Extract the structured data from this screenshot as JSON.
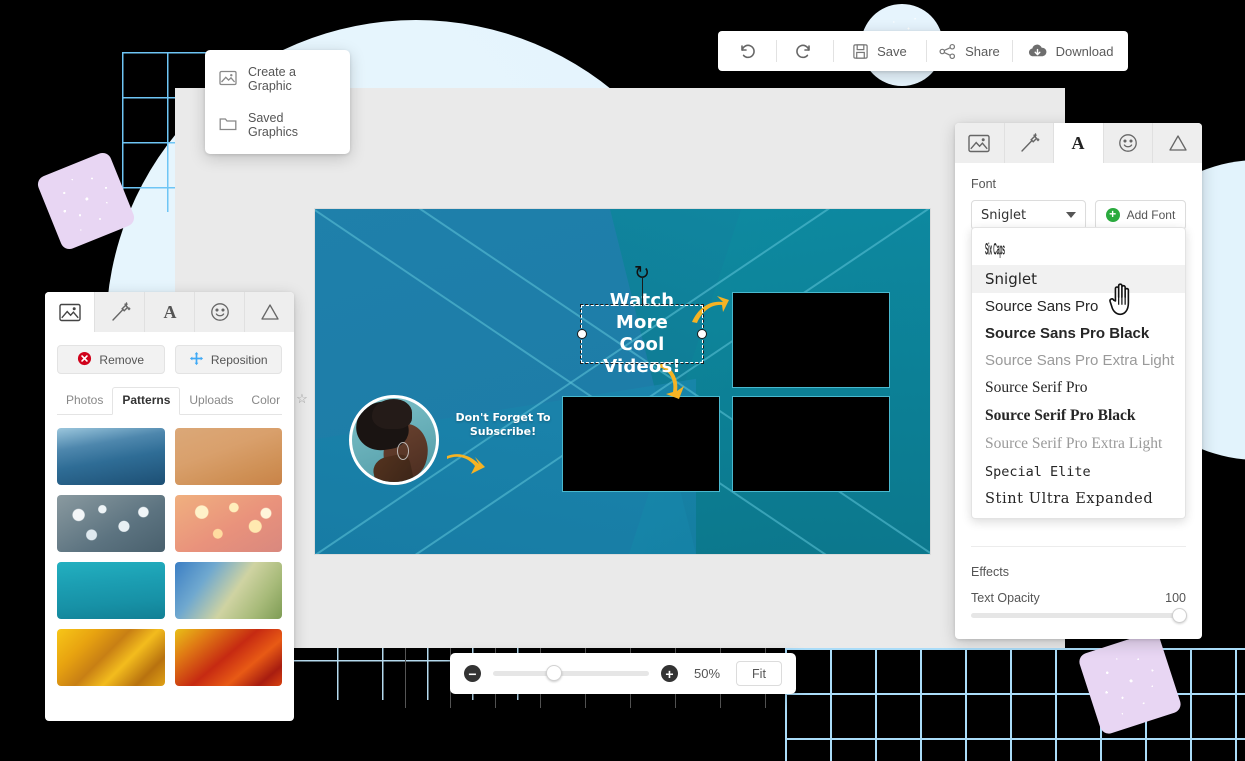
{
  "toolbar": {
    "undo": {
      "icon": "undo-icon",
      "label": ""
    },
    "redo": {
      "icon": "redo-icon",
      "label": ""
    },
    "save": {
      "icon": "floppy-disk-icon",
      "label": "Save"
    },
    "share": {
      "icon": "share-icon",
      "label": "Share"
    },
    "download": {
      "icon": "cloud-download-icon",
      "label": "Download"
    }
  },
  "graphics_menu": {
    "items": [
      {
        "label": "Create a Graphic",
        "icon": "image-icon"
      },
      {
        "label": "Saved Graphics",
        "icon": "folder-icon"
      }
    ]
  },
  "left_panel": {
    "tabs": [
      {
        "name": "image",
        "icon": "image-icon",
        "active": true
      },
      {
        "name": "effects",
        "icon": "magic-wand-icon",
        "active": false
      },
      {
        "name": "text",
        "icon": "letter-a-icon",
        "active": false
      },
      {
        "name": "stickers",
        "icon": "smiley-icon",
        "active": false
      },
      {
        "name": "shapes",
        "icon": "triangle-icon",
        "active": false
      }
    ],
    "actions": [
      {
        "label": "Remove",
        "icon": "remove-circle-icon",
        "color": "#d0021b"
      },
      {
        "label": "Reposition",
        "icon": "move-cross-icon",
        "color": "#3fa9f5"
      }
    ],
    "subtabs": [
      {
        "label": "Photos",
        "active": false
      },
      {
        "label": "Patterns",
        "active": true
      },
      {
        "label": "Uploads",
        "active": false
      },
      {
        "label": "Color",
        "active": false
      }
    ],
    "favorite_icon": "star-icon",
    "thumbnails": [
      {
        "name": "ocean-blue-gradient",
        "css": "linear-gradient(170deg,#9cc7dd 0%,#4e87ad 30%,#2f6d96 55%,#1d4f74 100%)"
      },
      {
        "name": "warm-tan-texture",
        "css": "linear-gradient(160deg,#dba878 0%,#d9a06c 40%,#cf9055 75%,#c98348 100%)"
      },
      {
        "name": "cool-bokeh-lights",
        "css": "radial-gradient(circle at 20% 35%,#f3f6f8 0 6%,transparent 7%),radial-gradient(circle at 42% 25%,#eef4f7 0 5%,transparent 6%),radial-gradient(circle at 62% 55%,#e8f0f4 0 7%,transparent 8%),radial-gradient(circle at 80% 30%,#f0f5f8 0 5%,transparent 6%),radial-gradient(circle at 32% 70%,#dfe9ef 0 6%,transparent 7%),linear-gradient(150deg,#8a9aa0,#5c7380 60%,#49606d)"
      },
      {
        "name": "warm-bokeh-lights",
        "css": "radial-gradient(circle at 25% 30%,#fff2c9 0 7%,transparent 8%),radial-gradient(circle at 55% 22%,#ffeebb 0 6%,transparent 7%),radial-gradient(circle at 75% 55%,#ffe9b0 0 7%,transparent 8%),radial-gradient(circle at 40% 68%,#ffdca0 0 6%,transparent 7%),radial-gradient(circle at 85% 32%,#fff6da 0 5%,transparent 6%),linear-gradient(150deg,#f0b07f,#e9927c 55%,#d9887e)"
      },
      {
        "name": "teal-gradient",
        "css": "linear-gradient(175deg,#23b0c0 0%,#1c9fb3 35%,#1791a6 70%,#128095 100%)"
      },
      {
        "name": "blue-green-blur",
        "css": "linear-gradient(125deg,#3b7ec4 0%,#6fa8cf 28%,#cfd3a2 55%,#a8bb7a 78%,#7e9c54 100%)"
      },
      {
        "name": "gold-polygon",
        "css": "linear-gradient(135deg,#f7c618 0%,#e8a310 25%,#c87f14 45%,#f3bc1d 62%,#b8720f 82%,#e0a215 100%)"
      },
      {
        "name": "red-orange-polygon",
        "css": "linear-gradient(140deg,#e8c018 0%,#e07a14 22%,#c62a12 48%,#e85a15 68%,#a81d10 86%,#d9420f 100%)"
      }
    ]
  },
  "right_panel": {
    "tabs": [
      {
        "name": "image",
        "icon": "image-icon",
        "active": false
      },
      {
        "name": "effects",
        "icon": "magic-wand-icon",
        "active": false
      },
      {
        "name": "text",
        "icon": "letter-a-icon",
        "active": true
      },
      {
        "name": "stickers",
        "icon": "smiley-icon",
        "active": false
      },
      {
        "name": "shapes",
        "icon": "triangle-icon",
        "active": false
      }
    ],
    "font_label": "Font",
    "font_selected": "Sniglet",
    "add_font_label": "Add Font",
    "add_font_icon": "plus-circle-icon",
    "font_options": [
      {
        "label": "Six Caps",
        "style": "sixcaps",
        "selected": false
      },
      {
        "label": "Sniglet",
        "style": "sniglet",
        "selected": true
      },
      {
        "label": "Source Sans Pro",
        "style": "ssp",
        "selected": false
      },
      {
        "label": "Source Sans Pro Black",
        "style": "ssp-black",
        "selected": false
      },
      {
        "label": "Source Sans Pro Extra Light",
        "style": "ssp-xl",
        "selected": false
      },
      {
        "label": "Source Serif Pro",
        "style": "serif",
        "selected": false
      },
      {
        "label": "Source Serif Pro Black",
        "style": "serif-bk",
        "selected": false
      },
      {
        "label": "Source Serif Pro Extra Light",
        "style": "serif-xl",
        "selected": false
      },
      {
        "label": "Special Elite",
        "style": "elite",
        "selected": false
      },
      {
        "label": "Stint Ultra Expanded",
        "style": "stint",
        "selected": false
      }
    ],
    "effects_title": "Effects",
    "text_opacity_label": "Text Opacity",
    "text_opacity_value": "100"
  },
  "canvas": {
    "selected_text": "Watch More\nCool Videos!",
    "selected_text_line1": "Watch More",
    "selected_text_line2": "Cool Videos!",
    "subscribe_line1": "Don't Forget To",
    "subscribe_line2": "Subscribe!",
    "rotate_handle_icon": "rotate-icon",
    "arrow_icon": "curved-arrow-icon",
    "accent_color": "#f5b324",
    "outline_color": "#49b9cf"
  },
  "zoombar": {
    "zoom_out_icon": "minus-circle-icon",
    "zoom_in_icon": "plus-circle-icon",
    "percent": "50%",
    "fit_label": "Fit"
  }
}
